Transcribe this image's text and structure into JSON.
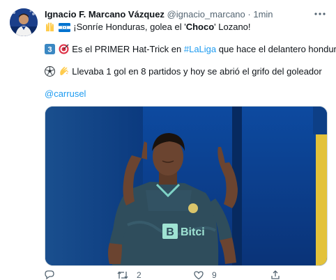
{
  "author": {
    "name": "Ignacio F. Marcano Vázquez",
    "handle": "@ignacio_marcano",
    "separator": "·",
    "time": "1min"
  },
  "more_icon": "more-horizontal-icon",
  "text": {
    "line1_prefix": "¡Sonríe Honduras, golea el '",
    "line1_bold": "Choco",
    "line1_suffix": "' Lozano!",
    "line2_prefix": "Es el PRIMER Hat-Trick en ",
    "line2_hashtag": "#LaLiga",
    "line2_suffix": " que hace el delantero hondureño",
    "line3": "Llevaba 1 gol en 8 partidos y hoy se abrió el grifo del goleador",
    "mention": "@carrusel",
    "keycap_digit": "3"
  },
  "media": {
    "sponsor_text": "Bitci",
    "sponsor_letter": "B"
  },
  "actions": {
    "reply_count": "",
    "retweet_count": "2",
    "like_count": "9"
  },
  "colors": {
    "link": "#1d9bf0",
    "secondary_text": "#536471",
    "jersey_teal": "#2f4d5c",
    "background_blue": "#0b3c8a",
    "flag_blue": "#0073cf"
  }
}
